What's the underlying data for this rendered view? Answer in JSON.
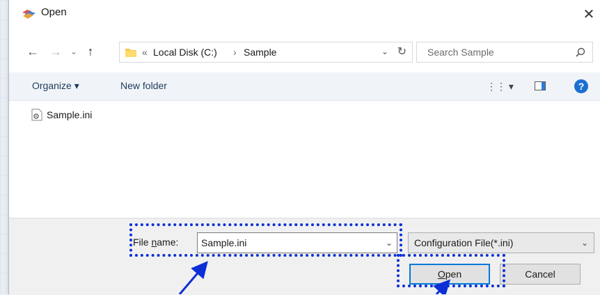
{
  "window": {
    "title": "Open",
    "close_glyph": "✕",
    "icon": "open-folder-icon"
  },
  "nav": {
    "back_glyph": "←",
    "forward_glyph": "→",
    "recent_glyph": "⌄",
    "up_glyph": "↑",
    "address": {
      "overflow": "«",
      "segments": [
        "Local Disk (C:)",
        "Sample"
      ],
      "separator": "›"
    },
    "dropdown_glyph": "⌄",
    "refresh_glyph": "↻"
  },
  "search": {
    "placeholder": "Search Sample"
  },
  "toolbar": {
    "organize_label": "Organize ▾",
    "new_folder_label": "New folder",
    "view_glyph": "⋮⋮ ▾",
    "help_glyph": "?"
  },
  "files": [
    {
      "name": "Sample.ini",
      "icon": "settings-file-icon"
    }
  ],
  "bottom": {
    "file_name_label_pre": "File ",
    "file_name_label_accel": "n",
    "file_name_label_post": "ame:",
    "file_name_value": "Sample.ini",
    "file_type_value": "Configuration File(*.ini)",
    "dropdown_glyph": "⌄",
    "open_accel": "O",
    "open_rest": "pen",
    "cancel_label": "Cancel"
  },
  "colors": {
    "accent": "#0078d7",
    "annotation": "#0c2fd6",
    "toolbar_bg": "#f0f4f9"
  }
}
